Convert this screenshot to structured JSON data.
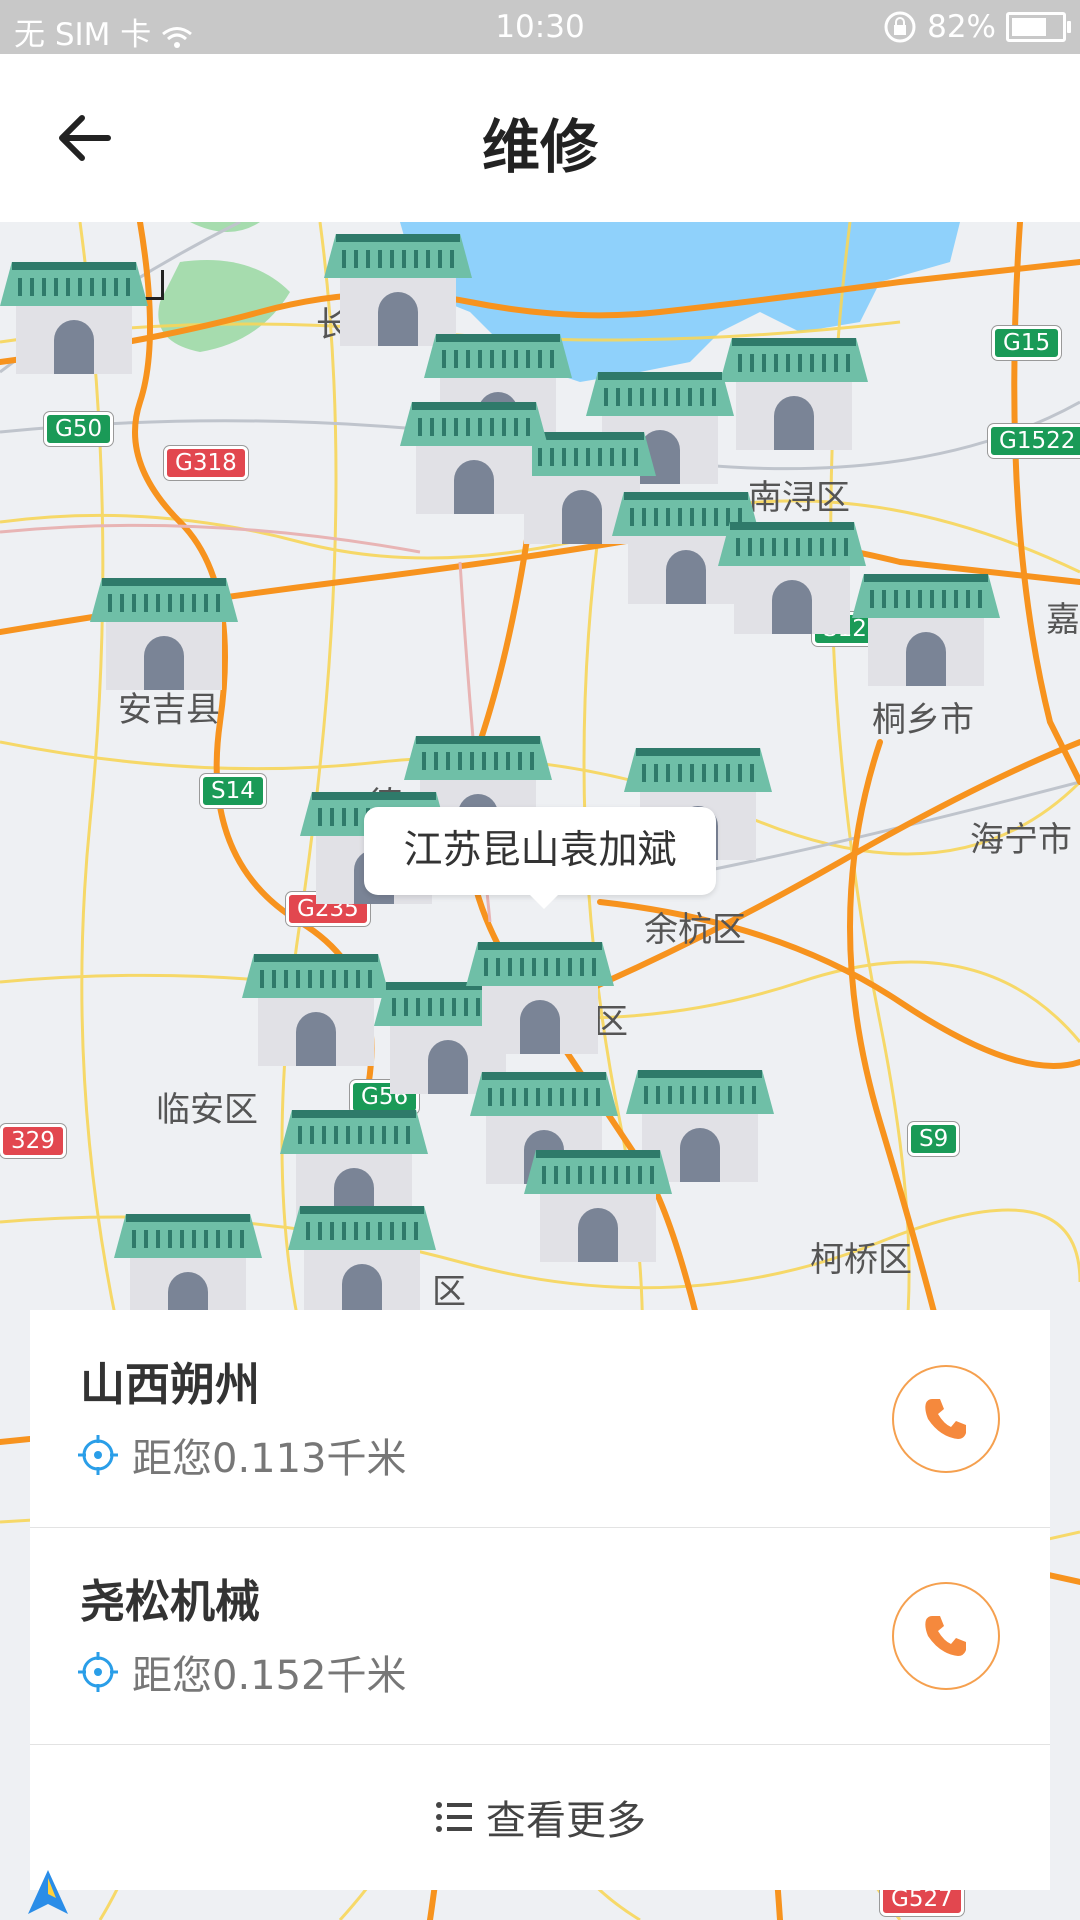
{
  "status_bar": {
    "carrier": "无 SIM 卡",
    "time": "10:30",
    "battery": "82%",
    "battery_level": 0.82
  },
  "header": {
    "title": "维修"
  },
  "map": {
    "scale": "20km",
    "labels": [
      "南浔区",
      "安吉县",
      "桐乡市",
      "海宁市",
      "余杭区",
      "临安区",
      "柯桥区",
      "嘉",
      "长",
      "德",
      "区",
      "区"
    ],
    "roads": [
      "G50",
      "G318",
      "G15",
      "G1522",
      "S14",
      "G235",
      "G56",
      "S9",
      "329",
      "S12",
      "G527"
    ],
    "tooltip": "江苏昆山袁加斌",
    "road_color": "#f7931e",
    "water_color": "#8fd1fb",
    "park_color": "#a6dcae"
  },
  "list": {
    "items": [
      {
        "name": "山西朔州",
        "distance": "距您0.113千米"
      },
      {
        "name": "尧松机械",
        "distance": "距您0.152千米"
      }
    ],
    "more": "查看更多",
    "accent_color": "#f5893d",
    "icon_color": "#2a9ee8"
  }
}
